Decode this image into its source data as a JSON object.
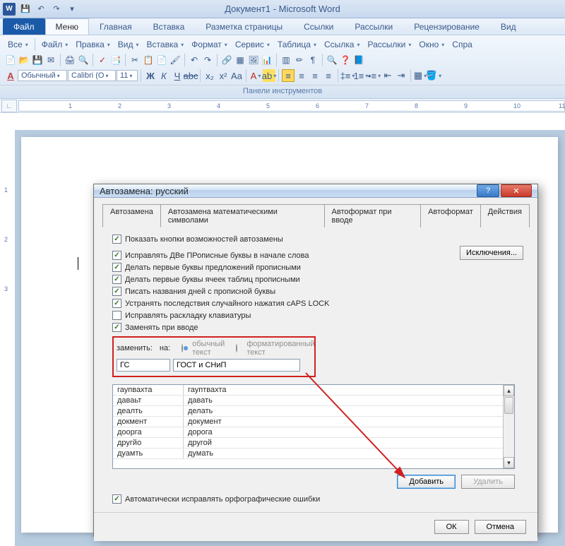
{
  "title": "Документ1 - Microsoft Word",
  "qat": {
    "word": "W"
  },
  "tabs": {
    "file": "Файл",
    "menu": "Меню",
    "home": "Главная",
    "insert": "Вставка",
    "layout": "Разметка страницы",
    "refs": "Ссылки",
    "mailings": "Рассылки",
    "review": "Рецензирование",
    "view": "Вид"
  },
  "menubar": {
    "all": "Все",
    "file": "Файл",
    "edit": "Правка",
    "view": "Вид",
    "insert": "Вставка",
    "format": "Формат",
    "service": "Сервис",
    "table": "Таблица",
    "link": "Ссылка",
    "mailings": "Рассылки",
    "window": "Окно",
    "help": "Спра"
  },
  "fmt": {
    "style_icon": "A",
    "style": "Обычный",
    "font": "Calibri (О",
    "size": "11"
  },
  "toolbar_caption": "Панели инструментов",
  "ruler": [
    "1",
    "2",
    "3",
    "4",
    "5",
    "6",
    "7",
    "8",
    "9",
    "10",
    "11"
  ],
  "vruler": [
    "1",
    "2",
    "3"
  ],
  "dialog": {
    "title": "Автозамена: русский",
    "tabs": {
      "t1": "Автозамена",
      "t2": "Автозамена математическими символами",
      "t3": "Автоформат при вводе",
      "t4": "Автоформат",
      "t5": "Действия"
    },
    "chk": {
      "show_btn": "Показать кнопки возможностей автозамены",
      "two_caps": "Исправлять ДВе ПРописные буквы в начале слова",
      "sentence": "Делать первые буквы предложений прописными",
      "cells": "Делать первые буквы ячеек таблиц прописными",
      "days": "Писать названия дней с прописной буквы",
      "capslock": "Устранять последствия случайного нажатия cAPS LOCK",
      "keyboard": "Исправлять раскладку клавиатуры",
      "replace": "Заменять при вводе",
      "auto_spell": "Автоматически исправлять орфографические ошибки"
    },
    "exceptions": "Исключения...",
    "replace_lbl": "заменить:",
    "with_lbl": "на:",
    "radio_plain": "обычный текст",
    "radio_fmt": "форматированный текст",
    "inp_from": "ГС",
    "inp_to": "ГОСТ и СНиП",
    "list": [
      {
        "from": "гаупвахта",
        "to": "гауптвахта"
      },
      {
        "from": "даваьт",
        "to": "давать"
      },
      {
        "from": "деалть",
        "to": "делать"
      },
      {
        "from": "докмент",
        "to": "документ"
      },
      {
        "from": "доорга",
        "to": "дорога"
      },
      {
        "from": "другйо",
        "to": "другой"
      },
      {
        "from": "дуамть",
        "to": "думать"
      }
    ],
    "btn_add": "Добавить",
    "btn_del": "Удалить",
    "btn_ok": "ОК",
    "btn_cancel": "Отмена"
  }
}
